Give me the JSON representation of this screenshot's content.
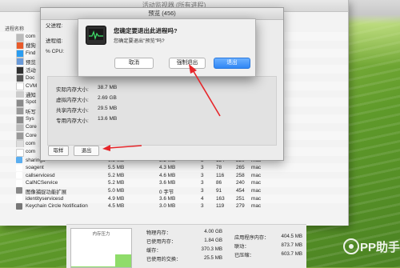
{
  "window_title": "活动监视器 (所有进程)",
  "column_header": "进程名称",
  "processes": [
    {
      "name": "com",
      "icon": "app-icon",
      "color": "#bbbbbb"
    },
    {
      "name": "搜狗",
      "icon": "sogou-icon",
      "color": "#e85a2a"
    },
    {
      "name": "Find",
      "icon": "finder-icon",
      "color": "#2a9cf0"
    },
    {
      "name": "预览",
      "icon": "preview-icon",
      "color": "#6a9ad8"
    },
    {
      "name": "活动",
      "icon": "activity-icon",
      "color": "#2f2f2f"
    },
    {
      "name": "Doc",
      "icon": "dock-icon",
      "color": "#555555"
    },
    {
      "name": "CVM",
      "icon": "blank-icon",
      "color": "#ffffff"
    },
    {
      "name": "通知",
      "icon": "notification-icon",
      "color": "#cccccc"
    },
    {
      "name": "Spot",
      "icon": "spotlight-icon",
      "color": "#8a8a8a"
    },
    {
      "name": "听写",
      "icon": "dictation-icon",
      "color": "#999999"
    },
    {
      "name": "Sys",
      "icon": "system-icon",
      "color": "#8a8a8a"
    },
    {
      "name": "Core",
      "icon": "core-icon",
      "color": "#bbbbbb"
    },
    {
      "name": "Core",
      "icon": "core-icon",
      "color": "#999999"
    },
    {
      "name": "com",
      "icon": "shield-icon",
      "color": "#dddddd"
    },
    {
      "name": "com",
      "icon": "blank-icon",
      "color": "#ffffff"
    }
  ],
  "visible_rows": [
    {
      "name": "sharingd",
      "icon": "folder-icon",
      "color": "#5aaef0",
      "mem": "6.3 MB",
      "comp": "3.2 MB",
      "threads": "3",
      "ports": "134",
      "pid": "220",
      "user": "mac"
    },
    {
      "name": "soagent",
      "icon": "blank-icon",
      "color": "#ffffff",
      "mem": "5.5 MB",
      "comp": "4.3 MB",
      "threads": "3",
      "ports": "78",
      "pid": "265",
      "user": "mac"
    },
    {
      "name": "callservicesd",
      "icon": "blank-icon",
      "color": "#ffffff",
      "mem": "5.2 MB",
      "comp": "4.6 MB",
      "threads": "3",
      "ports": "116",
      "pid": "258",
      "user": "mac"
    },
    {
      "name": "CalNCService",
      "icon": "blank-icon",
      "color": "#ffffff",
      "mem": "5.2 MB",
      "comp": "3.6 MB",
      "threads": "3",
      "ports": "86",
      "pid": "240",
      "user": "mac"
    },
    {
      "name": "图像捕捉功能扩展",
      "icon": "capture-icon",
      "color": "#888888",
      "mem": "5.0 MB",
      "comp": "0 字节",
      "threads": "3",
      "ports": "91",
      "pid": "454",
      "user": "mac"
    },
    {
      "name": "identityservicesd",
      "icon": "blank-icon",
      "color": "#ffffff",
      "mem": "4.9 MB",
      "comp": "3.6 MB",
      "threads": "4",
      "ports": "163",
      "pid": "251",
      "user": "mac"
    },
    {
      "name": "Keychain Circle Notification",
      "icon": "keychain-icon",
      "color": "#777777",
      "mem": "4.5 MB",
      "comp": "3.0 MB",
      "threads": "3",
      "ports": "119",
      "pid": "279",
      "user": "mac"
    }
  ],
  "memory_panel": {
    "graph_label": "内存压力",
    "pressure_level": 0.33,
    "rows_left": [
      {
        "label": "物理内存：",
        "value": "4.00 GB"
      },
      {
        "label": "已使用内存：",
        "value": "1.84 GB"
      },
      {
        "label": "缓存：",
        "value": "370.3 MB"
      },
      {
        "label": "已使用的交换：",
        "value": "25.5 MB"
      }
    ],
    "rows_right": [
      {
        "label": "应用程序内存：",
        "value": "404.5 MB"
      },
      {
        "label": "联动：",
        "value": "873.7 MB"
      },
      {
        "label": "已压缩：",
        "value": "603.7 MB"
      }
    ]
  },
  "info_window": {
    "title": "预览 (456)",
    "parent_label": "父进程:",
    "group_label": "进程组:",
    "cpu_label": "% CPU:",
    "memory_rows": [
      {
        "label": "实际内存大小:",
        "value": "38.7 MB"
      },
      {
        "label": "虚拟内存大小:",
        "value": "2.69 GB"
      },
      {
        "label": "共享内存大小:",
        "value": "29.5 MB"
      },
      {
        "label": "专用内存大小:",
        "value": "13.6 MB"
      }
    ],
    "sample_button": "取样",
    "quit_button": "退出"
  },
  "alert": {
    "title": "您确定要退出此进程吗?",
    "message": "您确定要退出\"预览\"吗?",
    "cancel": "取消",
    "force_quit": "强制退出",
    "quit": "退出"
  },
  "watermark": "PP助手",
  "colors": {
    "accent_blue": "#2f86f5",
    "annotation_red": "#e6262a",
    "desktop_green": "#6ea630"
  }
}
